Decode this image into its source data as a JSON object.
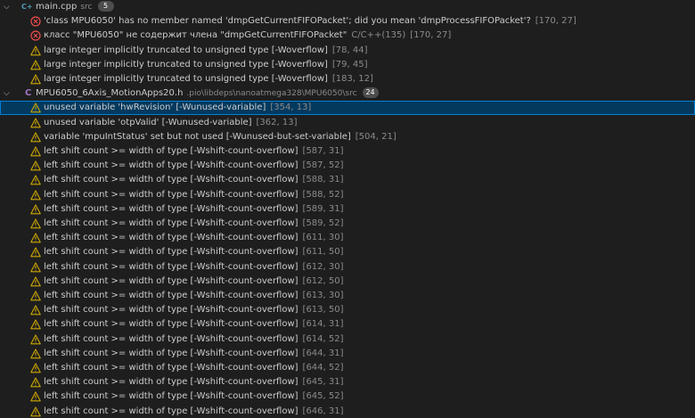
{
  "files": [
    {
      "name": "main.cpp",
      "path": "src",
      "icon": "cpp-file-icon",
      "count": "5",
      "problems": [
        {
          "severity": "error",
          "message": "'class MPU6050' has no member named 'dmpGetCurrentFIFOPacket'; did you mean 'dmpProcessFIFOPacket'?",
          "source": "",
          "location": "[170, 27]"
        },
        {
          "severity": "error",
          "message": "класс \"MPU6050\" не содержит члена \"dmpGetCurrentFIFOPacket\"",
          "source": "C/C++(135)",
          "location": "[170, 27]"
        },
        {
          "severity": "warning",
          "message": "large integer implicitly truncated to unsigned type [-Woverflow]",
          "source": "",
          "location": "[78, 44]"
        },
        {
          "severity": "warning",
          "message": "large integer implicitly truncated to unsigned type [-Woverflow]",
          "source": "",
          "location": "[79, 45]"
        },
        {
          "severity": "warning",
          "message": "large integer implicitly truncated to unsigned type [-Woverflow]",
          "source": "",
          "location": "[183, 12]"
        }
      ]
    },
    {
      "name": "MPU6050_6Axis_MotionApps20.h",
      "path": ".pio\\libdeps\\nanoatmega328\\MPU6050\\src",
      "icon": "c-header-file-icon",
      "count": "24",
      "problems": [
        {
          "severity": "warning",
          "message": "unused variable 'hwRevision' [-Wunused-variable]",
          "source": "",
          "location": "[354, 13]",
          "selected": true
        },
        {
          "severity": "warning",
          "message": "unused variable 'otpValid' [-Wunused-variable]",
          "source": "",
          "location": "[362, 13]"
        },
        {
          "severity": "warning",
          "message": "variable 'mpuIntStatus' set but not used [-Wunused-but-set-variable]",
          "source": "",
          "location": "[504, 21]"
        },
        {
          "severity": "warning",
          "message": "left shift count >= width of type [-Wshift-count-overflow]",
          "source": "",
          "location": "[587, 31]"
        },
        {
          "severity": "warning",
          "message": "left shift count >= width of type [-Wshift-count-overflow]",
          "source": "",
          "location": "[587, 52]"
        },
        {
          "severity": "warning",
          "message": "left shift count >= width of type [-Wshift-count-overflow]",
          "source": "",
          "location": "[588, 31]"
        },
        {
          "severity": "warning",
          "message": "left shift count >= width of type [-Wshift-count-overflow]",
          "source": "",
          "location": "[588, 52]"
        },
        {
          "severity": "warning",
          "message": "left shift count >= width of type [-Wshift-count-overflow]",
          "source": "",
          "location": "[589, 31]"
        },
        {
          "severity": "warning",
          "message": "left shift count >= width of type [-Wshift-count-overflow]",
          "source": "",
          "location": "[589, 52]"
        },
        {
          "severity": "warning",
          "message": "left shift count >= width of type [-Wshift-count-overflow]",
          "source": "",
          "location": "[611, 30]"
        },
        {
          "severity": "warning",
          "message": "left shift count >= width of type [-Wshift-count-overflow]",
          "source": "",
          "location": "[611, 50]"
        },
        {
          "severity": "warning",
          "message": "left shift count >= width of type [-Wshift-count-overflow]",
          "source": "",
          "location": "[612, 30]"
        },
        {
          "severity": "warning",
          "message": "left shift count >= width of type [-Wshift-count-overflow]",
          "source": "",
          "location": "[612, 50]"
        },
        {
          "severity": "warning",
          "message": "left shift count >= width of type [-Wshift-count-overflow]",
          "source": "",
          "location": "[613, 30]"
        },
        {
          "severity": "warning",
          "message": "left shift count >= width of type [-Wshift-count-overflow]",
          "source": "",
          "location": "[613, 50]"
        },
        {
          "severity": "warning",
          "message": "left shift count >= width of type [-Wshift-count-overflow]",
          "source": "",
          "location": "[614, 31]"
        },
        {
          "severity": "warning",
          "message": "left shift count >= width of type [-Wshift-count-overflow]",
          "source": "",
          "location": "[614, 52]"
        },
        {
          "severity": "warning",
          "message": "left shift count >= width of type [-Wshift-count-overflow]",
          "source": "",
          "location": "[644, 31]"
        },
        {
          "severity": "warning",
          "message": "left shift count >= width of type [-Wshift-count-overflow]",
          "source": "",
          "location": "[644, 52]"
        },
        {
          "severity": "warning",
          "message": "left shift count >= width of type [-Wshift-count-overflow]",
          "source": "",
          "location": "[645, 31]"
        },
        {
          "severity": "warning",
          "message": "left shift count >= width of type [-Wshift-count-overflow]",
          "source": "",
          "location": "[645, 52]"
        },
        {
          "severity": "warning",
          "message": "left shift count >= width of type [-Wshift-count-overflow]",
          "source": "",
          "location": "[646, 31]"
        }
      ]
    }
  ],
  "colors": {
    "background": "#1e1e1e",
    "error": "#f14c4c",
    "warning": "#cca700",
    "selection": "#04395e",
    "selection_border": "#007fd4",
    "cpp_icon": "#519aba",
    "h_icon": "#a074c4"
  }
}
